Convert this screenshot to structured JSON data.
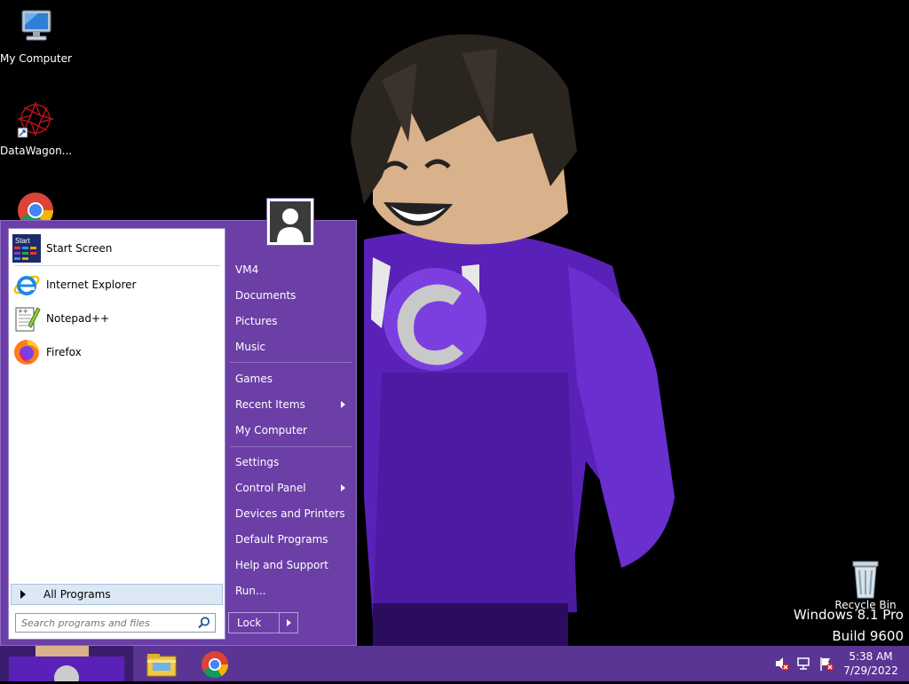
{
  "desktop": {
    "icons": [
      {
        "label": "My Computer",
        "icon": "computer-icon"
      },
      {
        "label": "DataWagon...",
        "icon": "datawagon-icon"
      },
      {
        "label": "",
        "icon": "chrome-icon"
      },
      {
        "label": "Recycle Bin",
        "icon": "recycle-bin-icon"
      }
    ],
    "watermark": {
      "line1": "Windows 8.1 Pro",
      "line2": "Build 9600"
    }
  },
  "start_menu": {
    "start_screen_badge": "Start",
    "programs": [
      {
        "label": "Start Screen",
        "icon": "start-screen-icon"
      },
      {
        "label": "Internet Explorer",
        "icon": "internet-explorer-icon"
      },
      {
        "label": "Notepad++",
        "icon": "notepad-plus-plus-icon"
      },
      {
        "label": "Firefox",
        "icon": "firefox-icon"
      }
    ],
    "all_programs": "All Programs",
    "search_placeholder": "Search programs and files",
    "right_items": [
      {
        "label": "VM4"
      },
      {
        "label": "Documents"
      },
      {
        "label": "Pictures"
      },
      {
        "label": "Music"
      },
      {
        "label": "Games"
      },
      {
        "label": "Recent Items",
        "submenu": true
      },
      {
        "label": "My Computer"
      },
      {
        "label": "Settings"
      },
      {
        "label": "Control Panel",
        "submenu": true
      },
      {
        "label": "Devices and Printers"
      },
      {
        "label": "Default Programs"
      },
      {
        "label": "Help and Support"
      },
      {
        "label": "Run..."
      }
    ],
    "lock_label": "Lock"
  },
  "taskbar": {
    "pinned": [
      {
        "icon": "file-explorer-icon"
      },
      {
        "icon": "chrome-icon"
      }
    ],
    "tray_icons": [
      "volume-muted-icon",
      "network-icon",
      "action-center-flag-icon"
    ],
    "time": "5:38 AM",
    "date": "7/29/2022"
  },
  "colors": {
    "accent": "#6b3fa6",
    "taskbar": "#5a3593"
  }
}
